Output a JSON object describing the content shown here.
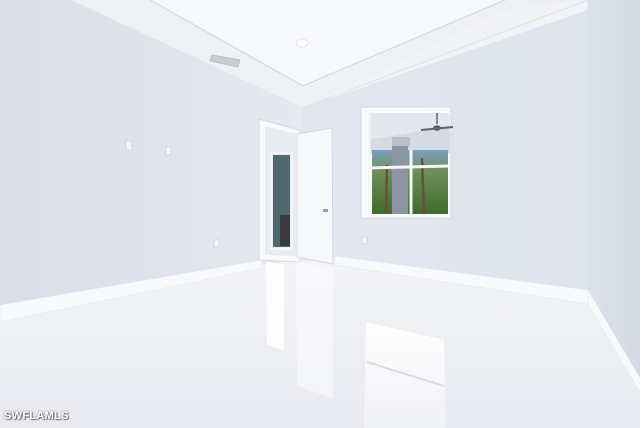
{
  "photo": {
    "subject": "empty-room-interior",
    "watermark_text": "SWFLAMLS",
    "colors": {
      "wall": "#e4e7ee",
      "ceiling": "#f4f5f8",
      "floor": "#eef0f4",
      "trim": "#f7f8fa",
      "foliage": "#3f6b2c"
    }
  }
}
